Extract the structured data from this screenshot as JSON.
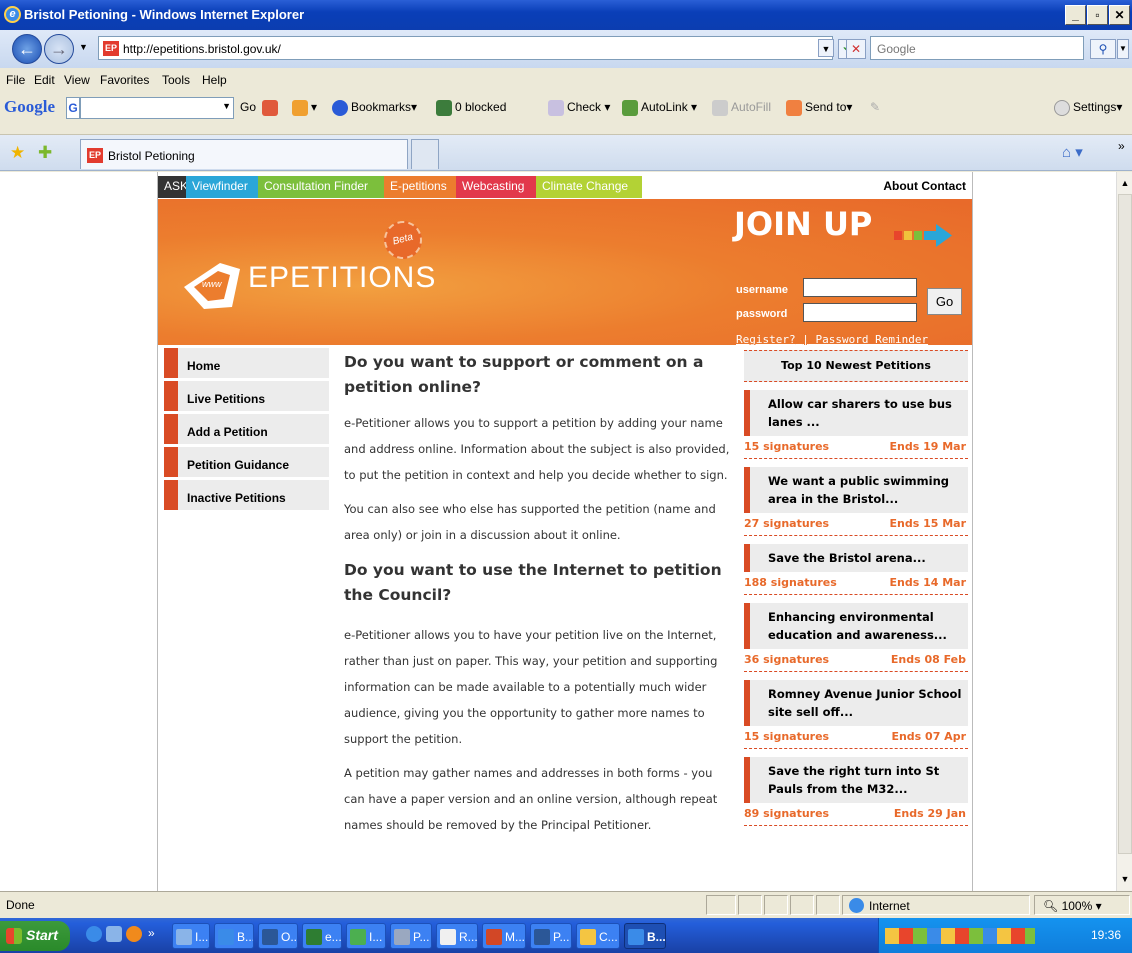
{
  "window": {
    "title": "Bristol Petioning - Windows Internet Explorer"
  },
  "address": {
    "url": "http://epetitions.bristol.gov.uk/",
    "search_placeholder": "Google"
  },
  "menu": [
    "File",
    "Edit",
    "View",
    "Favorites",
    "Tools",
    "Help"
  ],
  "google_toolbar": {
    "brand": "Google",
    "go": "Go",
    "bookmarks": "Bookmarks",
    "blocked": "0 blocked",
    "check": "Check",
    "autolink": "AutoLink",
    "autofill": "AutoFill",
    "sendto": "Send to",
    "settings": "Settings"
  },
  "tab": {
    "label": "Bristol Petioning"
  },
  "site": {
    "topnav": [
      {
        "label": "ASK",
        "color": "#333333"
      },
      {
        "label": "Viewfinder",
        "color": "#2aa6d8"
      },
      {
        "label": "Consultation Finder",
        "color": "#7cbf3c"
      },
      {
        "label": "E-petitions",
        "color": "#ec7d2e"
      },
      {
        "label": "Webcasting",
        "color": "#e2384b"
      },
      {
        "label": "Climate Change",
        "color": "#b3d235"
      }
    ],
    "about_contact": "About Contact",
    "logo_text": "EPETITIONS",
    "logo_www": "www",
    "beta": "Beta",
    "join_up": "JOIN UP",
    "username_label": "username",
    "password_label": "password",
    "go_button": "Go",
    "register": "Register?",
    "separator": "|",
    "reminder": "Password Reminder",
    "left_nav": [
      "Home",
      "Live Petitions",
      "Add a Petition",
      "Petition Guidance",
      "Inactive Petitions"
    ],
    "content": {
      "h1": "Do you want to support or comment on a petition online?",
      "p1": "e-Petitioner allows you to support a petition by adding your name and address online. Information about the subject is also provided, to put the petition in context and help you decide whether to sign.",
      "p2": "You can also see who else has supported the petition (name and area only) or join in a discussion about it online.",
      "h2": "Do you want to use the Internet to petition the Council?",
      "p3": "e-Petitioner allows you to have your petition live on the Internet, rather than just on paper. This way, your petition and supporting information can be made available to a potentially much wider audience, giving you the opportunity to gather more names to support the petition.",
      "p4": "A petition may gather names and addresses in both forms - you can have a paper version and an online version, although repeat names should be removed by the Principal Petitioner."
    },
    "top10_title": "Top 10 Newest Petitions",
    "petitions": [
      {
        "title": "Allow car sharers to use bus lanes ...",
        "signatures": "15 signatures",
        "ends": "Ends 19 Mar"
      },
      {
        "title": "We want a public swimming area in the Bristol...",
        "signatures": "27 signatures",
        "ends": "Ends 15 Mar"
      },
      {
        "title": "Save the Bristol arena...",
        "signatures": "188 signatures",
        "ends": "Ends 14 Mar"
      },
      {
        "title": "Enhancing environmental education and awareness...",
        "signatures": "36 signatures",
        "ends": "Ends 08 Feb"
      },
      {
        "title": "Romney Avenue Junior School site sell off...",
        "signatures": "15 signatures",
        "ends": "Ends 07 Apr"
      },
      {
        "title": "Save the right turn into St Pauls from the M32...",
        "signatures": "89 signatures",
        "ends": "Ends 29 Jan"
      }
    ]
  },
  "status": {
    "text": "Done",
    "zone": "Internet",
    "zoom": "100%"
  },
  "taskbar": {
    "start": "Start",
    "items": [
      "I...",
      "B...",
      "O...",
      "e...",
      "I...",
      "P...",
      "R...",
      "M...",
      "P...",
      "C...",
      "B..."
    ],
    "clock": "19:36"
  }
}
